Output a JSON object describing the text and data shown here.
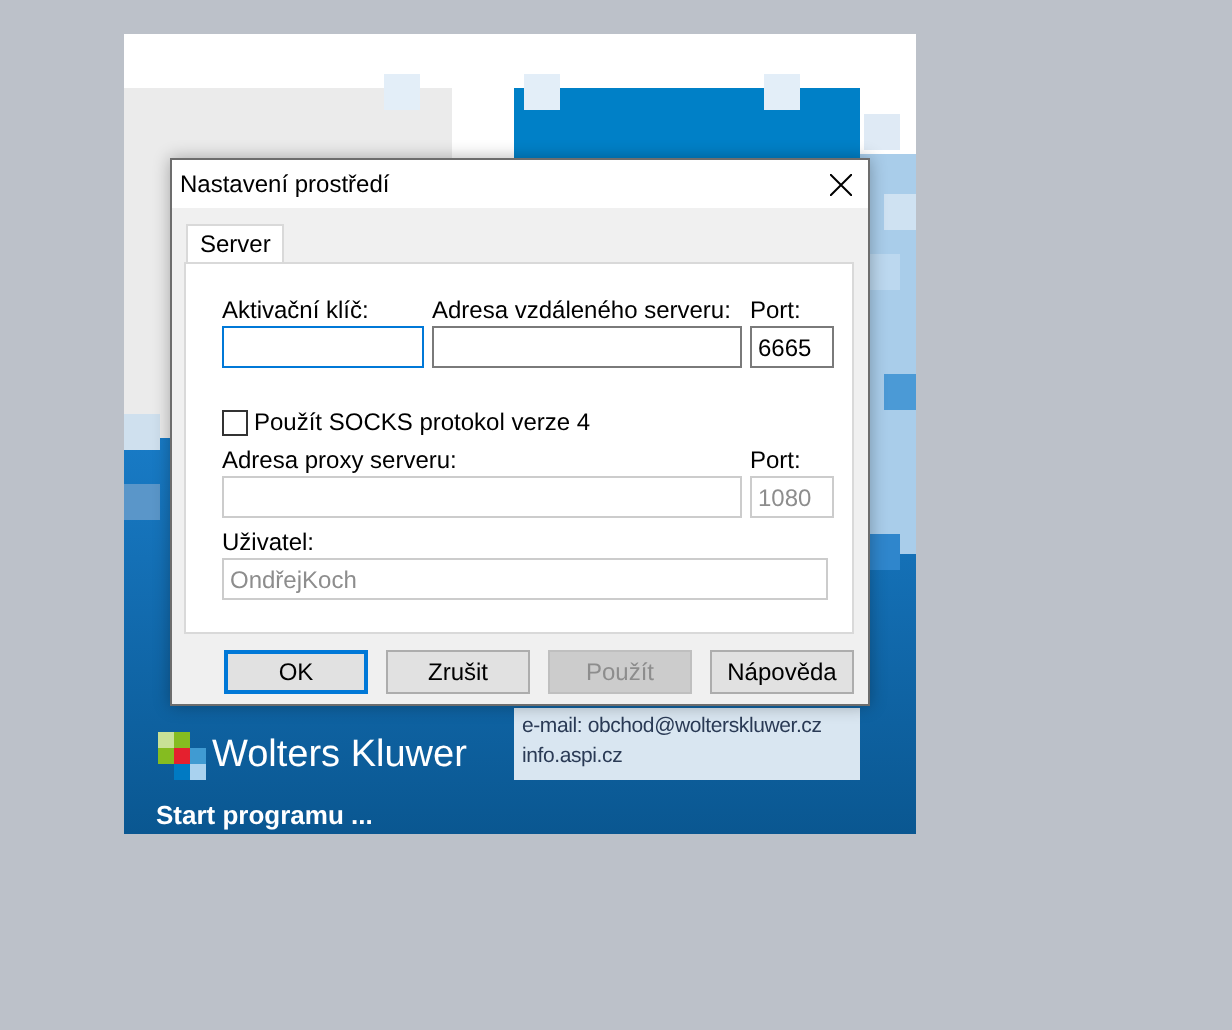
{
  "splash": {
    "brand": "Wolters Kluwer",
    "status": "Start programu ...",
    "contact": [
      "e-mail: obchod@wolterskluwer.cz",
      "info.aspi.cz"
    ]
  },
  "dialog": {
    "title": "Nastavení prostředí",
    "tabs": [
      {
        "label": "Server",
        "selected": true
      }
    ],
    "rows": [
      {
        "kind": "fields",
        "fields": [
          {
            "label": "Aktivační klíč:",
            "focused": true,
            "disabled": false
          },
          {
            "label": "Adresa vzdáleného serveru:",
            "focused": false,
            "disabled": false
          },
          {
            "label": "Port:",
            "value": "6665",
            "focused": false,
            "disabled": false
          }
        ]
      },
      {
        "kind": "checkbox",
        "label": "Použít SOCKS protokol verze 4",
        "checked": false
      },
      {
        "kind": "fields",
        "fields": [
          {
            "label": "Adresa proxy serveru:",
            "focused": false,
            "disabled": true
          },
          {
            "label": "Port:",
            "value": "1080",
            "focused": false,
            "disabled": true
          }
        ]
      },
      {
        "kind": "fields",
        "fields": [
          {
            "label": "Uživatel:",
            "value": "OndřejKoch",
            "focused": false,
            "disabled": true
          }
        ]
      }
    ],
    "buttons": [
      {
        "label": "OK",
        "default": true,
        "disabled": false
      },
      {
        "label": "Zrušit",
        "default": false,
        "disabled": false
      },
      {
        "label": "Použít",
        "default": false,
        "disabled": true
      },
      {
        "label": "Nápověda",
        "default": false,
        "disabled": false
      }
    ]
  }
}
